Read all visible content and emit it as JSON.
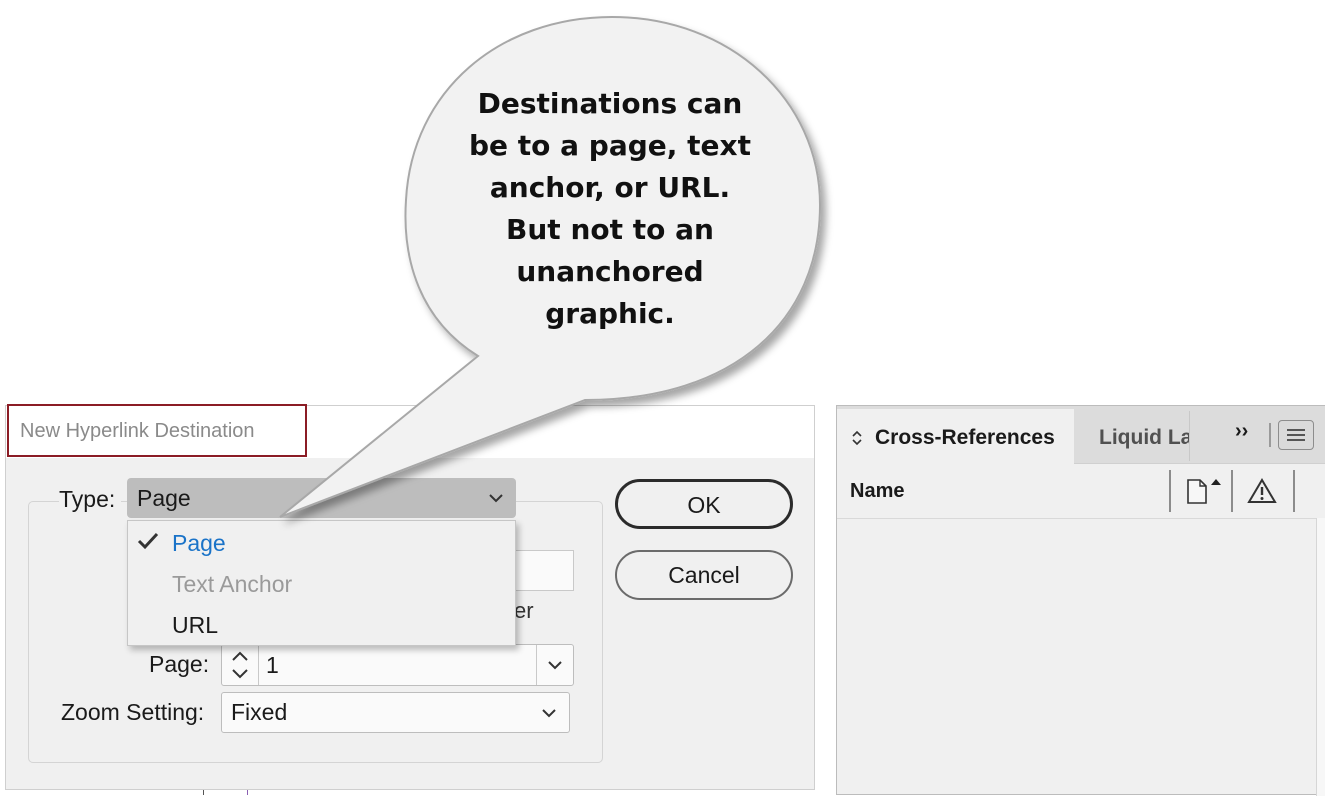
{
  "dialog": {
    "title": "New Hyperlink Destination",
    "type_label": "Type:",
    "type_value": "Page",
    "menu_items": [
      {
        "label": "Page",
        "state": "selected"
      },
      {
        "label": "Text Anchor",
        "state": "disabled"
      },
      {
        "label": "URL",
        "state": "normal"
      }
    ],
    "hidden_text": "er",
    "page_label": "Page:",
    "page_value": "1",
    "zoom_label": "Zoom Setting:",
    "zoom_value": "Fixed",
    "ok_label": "OK",
    "cancel_label": "Cancel"
  },
  "panel": {
    "tab_active": "Cross-References",
    "tab_next": "Liquid La",
    "overflow": "››",
    "column_name": "Name"
  },
  "callout": {
    "text": "Destinations can\nbe to a page, text\nanchor, or URL.\nBut not to an\nunanchored\ngraphic."
  },
  "colors": {
    "title_border": "#8b1c25",
    "selected_item": "#1a73c8",
    "disabled_item": "#9a9a9a"
  },
  "icons": [
    "check-icon",
    "chevron-down-icon",
    "stepper-up-down-icon",
    "sort-updown-icon",
    "panel-menu-icon",
    "new-page-icon",
    "warning-icon"
  ]
}
